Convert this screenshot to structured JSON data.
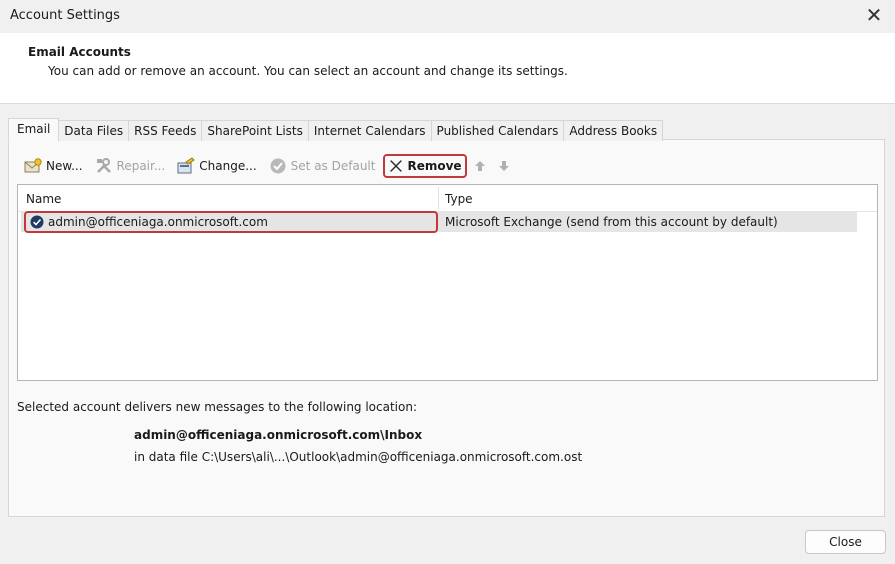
{
  "window": {
    "title": "Account Settings",
    "close_glyph": "✕"
  },
  "header": {
    "title": "Email Accounts",
    "description": "You can add or remove an account. You can select an account and change its settings."
  },
  "tabs": [
    {
      "label": "Email",
      "active": true
    },
    {
      "label": "Data Files"
    },
    {
      "label": "RSS Feeds"
    },
    {
      "label": "SharePoint Lists"
    },
    {
      "label": "Internet Calendars"
    },
    {
      "label": "Published Calendars"
    },
    {
      "label": "Address Books"
    }
  ],
  "toolbar": {
    "new_label": "New...",
    "repair_label": "Repair...",
    "change_label": "Change...",
    "set_default_label": "Set as Default",
    "remove_label": "Remove"
  },
  "list": {
    "col_name": "Name",
    "col_type": "Type",
    "rows": [
      {
        "name": "admin@officeniaga.onmicrosoft.com",
        "type": "Microsoft Exchange (send from this account by default)"
      }
    ]
  },
  "delivery": {
    "label": "Selected account delivers new messages to the following location:",
    "location": "admin@officeniaga.onmicrosoft.com\\Inbox",
    "data_file": "in data file C:\\Users\\ali\\...\\Outlook\\admin@officeniaga.onmicrosoft.com.ost"
  },
  "footer": {
    "close_label": "Close"
  },
  "colors": {
    "highlight_border": "#c0393b",
    "selected_row": "#e5e5e5",
    "check_icon": "#1f3b63"
  }
}
